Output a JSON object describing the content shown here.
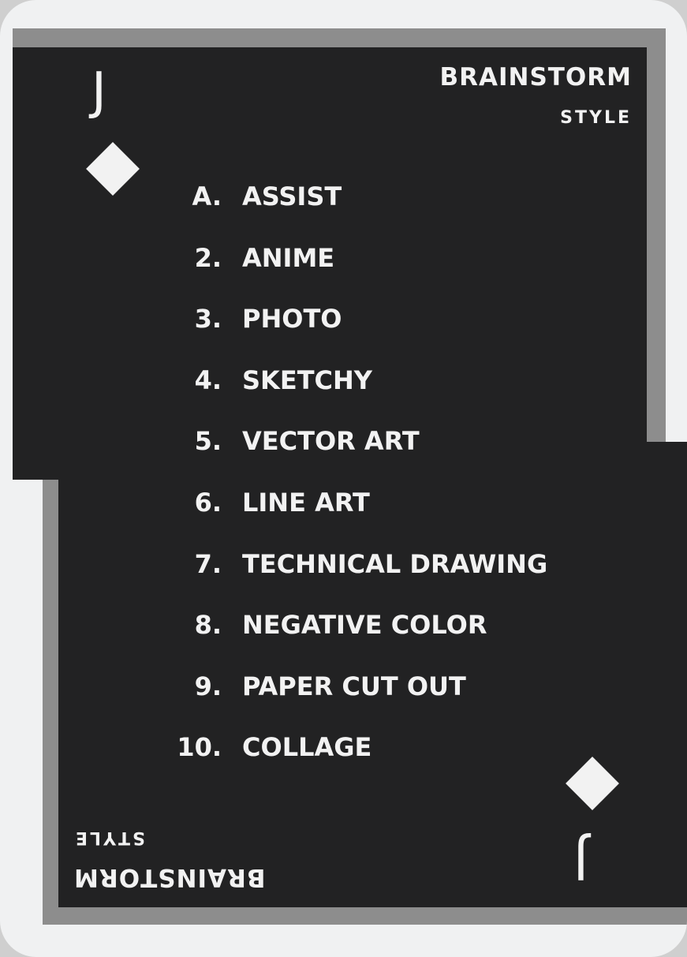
{
  "card": {
    "rank": "J",
    "suit": "diamond-icon",
    "title": "BRAINSTORM",
    "subtitle": "STYLE",
    "colors": {
      "panel": "#222223",
      "frame": "#8d8d8d",
      "card": "#f0f1f2",
      "text": "#f2f2f2"
    }
  },
  "items": [
    {
      "num": "A.",
      "label": "ASSIST"
    },
    {
      "num": "2.",
      "label": "ANIME"
    },
    {
      "num": "3.",
      "label": "PHOTO"
    },
    {
      "num": "4.",
      "label": "SKETCHY"
    },
    {
      "num": "5.",
      "label": "VECTOR ART"
    },
    {
      "num": "6.",
      "label": "LINE ART"
    },
    {
      "num": "7.",
      "label": "TECHNICAL DRAWING"
    },
    {
      "num": "8.",
      "label": "NEGATIVE COLOR"
    },
    {
      "num": "9.",
      "label": "PAPER CUT OUT"
    },
    {
      "num": "10.",
      "label": "COLLAGE"
    }
  ]
}
